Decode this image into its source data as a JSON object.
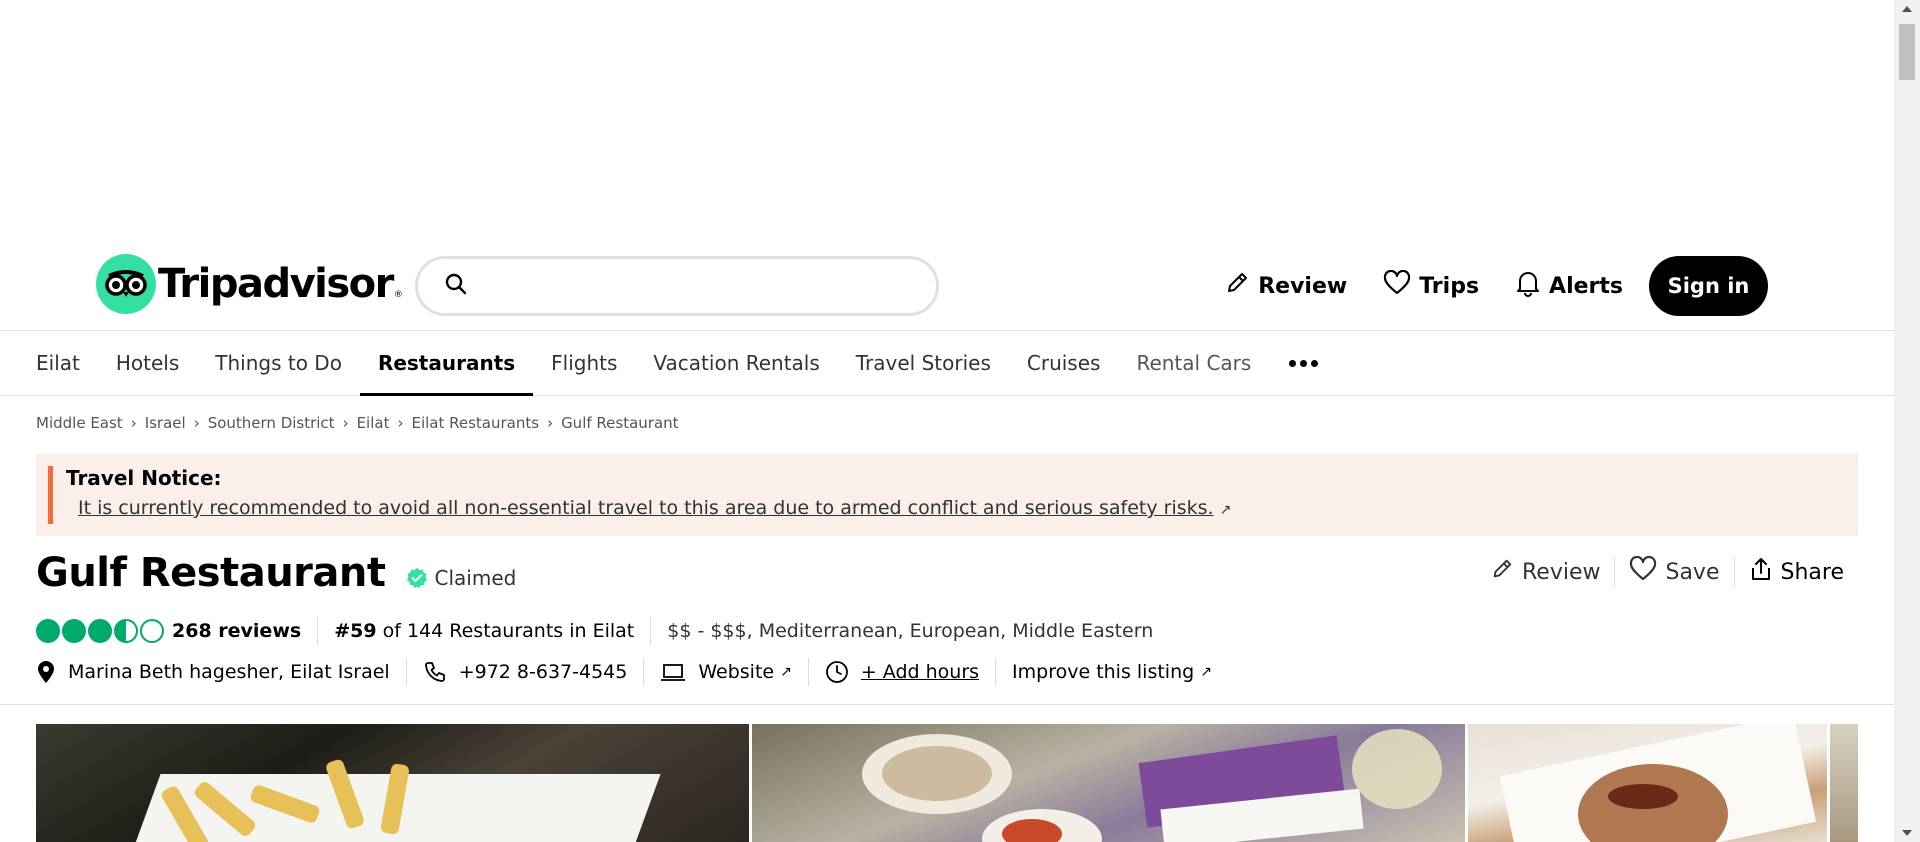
{
  "header": {
    "logo_text": "Tripadvisor",
    "logo_tm": "®",
    "search_placeholder": "",
    "actions": {
      "review": "Review",
      "trips": "Trips",
      "alerts": "Alerts",
      "signin": "Sign in"
    }
  },
  "nav": {
    "items": [
      "Eilat",
      "Hotels",
      "Things to Do",
      "Restaurants",
      "Flights",
      "Vacation Rentals",
      "Travel Stories",
      "Cruises",
      "Rental Cars"
    ],
    "active": "Restaurants"
  },
  "breadcrumb": [
    "Middle East",
    "Israel",
    "Southern District",
    "Eilat",
    "Eilat Restaurants",
    "Gulf Restaurant"
  ],
  "notice": {
    "title": "Travel Notice:",
    "message": "It is currently recommended to avoid all non-essential travel to this area due to armed conflict and serious safety risks."
  },
  "restaurant": {
    "name": "Gulf Restaurant",
    "claimed_label": "Claimed",
    "rating": 3.5,
    "rating_max": 5,
    "reviews": "268 reviews",
    "rank_prefix": "#59",
    "rank_suffix": " of 144 Restaurants in Eilat",
    "price_cuisine": "$$ - $$$, Mediterranean, European, Middle Eastern",
    "address": "Marina Beth hagesher, Eilat Israel",
    "phone": "+972 8-637-4545",
    "website_label": "Website",
    "add_hours_label": "+ Add hours",
    "improve_label": "Improve this listing"
  },
  "title_actions": {
    "review": "Review",
    "save": "Save",
    "share": "Share"
  },
  "colors": {
    "brand_green": "#34e0a1",
    "rating_green": "#00aa6c",
    "notice_bg": "#fbefe9",
    "notice_bar": "#f36c3d"
  }
}
